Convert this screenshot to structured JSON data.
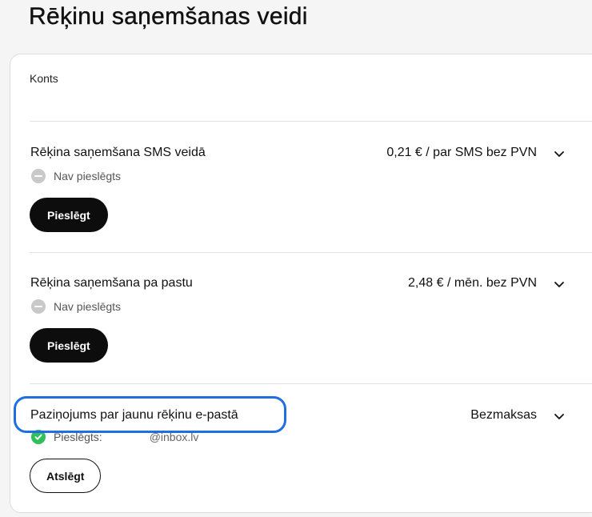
{
  "page": {
    "title": "Rēķinu saņemšanas veidi"
  },
  "account": {
    "label": "Konts"
  },
  "options": [
    {
      "title": "Rēķina saņemšana SMS veidā",
      "price": "0,21 € / par SMS bez PVN",
      "status": "Nav pieslēgts",
      "button": "Pieslēgt"
    },
    {
      "title": "Rēķina saņemšana pa pastu",
      "price": "2,48 € / mēn. bez PVN",
      "status": "Nav pieslēgts",
      "button": "Pieslēgt"
    },
    {
      "title": "Paziņojums par jaunu rēķinu e-pastā",
      "price": "Bezmaksas",
      "status": "Pieslēgts:",
      "email": "@inbox.lv",
      "button": "Atslēgt"
    }
  ],
  "colors": {
    "accent_highlight": "#1f6fe0",
    "status_connected": "#2fbf5b",
    "status_disconnected": "#c9c9c9",
    "primary_button": "#0d0d0d"
  },
  "icons": [
    "chevron-down-icon",
    "minus-circle-icon",
    "check-circle-icon"
  ]
}
